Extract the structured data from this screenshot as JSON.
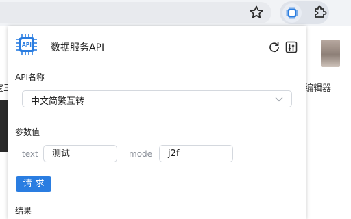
{
  "browser": {
    "star_icon": "star-icon",
    "extension_icon": "api-chip-icon",
    "puzzle_icon": "puzzle-icon"
  },
  "background_page": {
    "right_label": "编辑器",
    "left_label": "宝三"
  },
  "popup": {
    "title": "数据服务API",
    "logo_text": "API",
    "logo_color": "#2a7de1",
    "api_name_label": "API名称",
    "api_select_value": "中文简繁互转",
    "params_label": "参数值",
    "params": [
      {
        "name": "text",
        "value": "测试"
      },
      {
        "name": "mode",
        "value": "j2f"
      }
    ],
    "request_button": "请求",
    "result_label": "结果",
    "accent_color": "#2a7de1"
  }
}
